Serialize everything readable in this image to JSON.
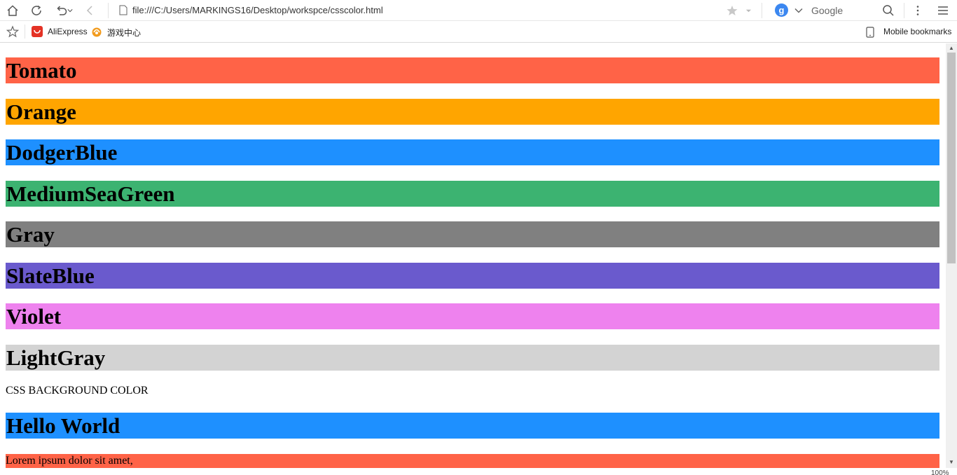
{
  "browser": {
    "url": "file:///C:/Users/MARKINGS16/Desktop/workspce/csscolor.html",
    "search_engine": "Google",
    "search_badge": "g"
  },
  "bookmarks": {
    "items": [
      {
        "label": "AliExpress",
        "icon": "aliexpress-icon"
      },
      {
        "label": "游戏中心",
        "icon": "game-center-icon"
      }
    ],
    "mobile_label": "Mobile bookmarks"
  },
  "page": {
    "headings": [
      {
        "text": "Tomato",
        "color": "#ff6347"
      },
      {
        "text": "Orange",
        "color": "#ffa500"
      },
      {
        "text": "DodgerBlue",
        "color": "#1e90ff"
      },
      {
        "text": "MediumSeaGreen",
        "color": "#3cb371"
      },
      {
        "text": "Gray",
        "color": "#808080"
      },
      {
        "text": "SlateBlue",
        "color": "#6a5acd"
      },
      {
        "text": "Violet",
        "color": "#ee82ee"
      },
      {
        "text": "LightGray",
        "color": "#d3d3d3"
      }
    ],
    "section_title": "CSS BACKGROUND COLOR",
    "hello": {
      "text": "Hello World",
      "color": "#1e90ff"
    },
    "paragraph": {
      "text": "Lorem ipsum dolor sit amet,",
      "color": "#ff6347"
    }
  },
  "status": {
    "zoom": "100%"
  }
}
